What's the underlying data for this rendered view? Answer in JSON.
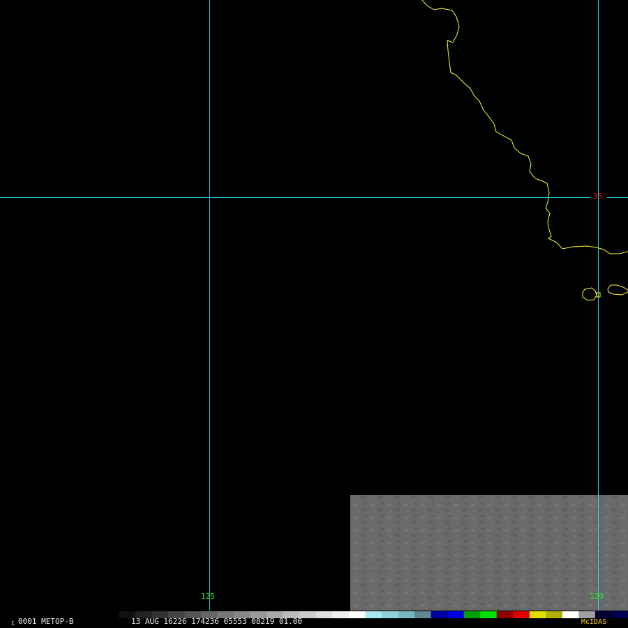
{
  "satellite": {
    "frame_number": "0001",
    "frame_prefix": "1",
    "name": "METOP-B",
    "datetime_line": "13 AUG 16226 174236 05553 08219 01.00",
    "brand": "McIDAS"
  },
  "grid": {
    "longitude_labels": [
      "125",
      "120"
    ],
    "latitude_labels": [
      "35"
    ],
    "grid_line_color": "#2fd0e8",
    "longitude_label_color": "#22e022",
    "latitude_label_color": "#e02020"
  },
  "coastline": {
    "color": "#ffff33"
  },
  "imagery": {
    "tone": "#6b6b6b"
  },
  "colorbar": {
    "segments": [
      {
        "color": "#000000"
      },
      {
        "color": "#111111"
      },
      {
        "color": "#222222"
      },
      {
        "color": "#333333"
      },
      {
        "color": "#444444"
      },
      {
        "color": "#555555"
      },
      {
        "color": "#666666"
      },
      {
        "color": "#777777"
      },
      {
        "color": "#888888"
      },
      {
        "color": "#999999"
      },
      {
        "color": "#aaaaaa"
      },
      {
        "color": "#bbbbbb"
      },
      {
        "color": "#cccccc"
      },
      {
        "color": "#dddddd"
      },
      {
        "color": "#eeeeee"
      },
      {
        "color": "#ffffff"
      },
      {
        "color": "#a8e8ee"
      },
      {
        "color": "#90d0d8"
      },
      {
        "color": "#78b8c0"
      },
      {
        "color": "#608890"
      },
      {
        "color": "#0000a0"
      },
      {
        "color": "#0000e0"
      },
      {
        "color": "#00a000"
      },
      {
        "color": "#00e000"
      },
      {
        "color": "#900000"
      },
      {
        "color": "#e00000"
      },
      {
        "color": "#e0e000"
      },
      {
        "color": "#b0b000"
      },
      {
        "color": "#ffffff"
      },
      {
        "color": "#a0a0a0"
      },
      {
        "color": "#000030"
      },
      {
        "color": "#000050"
      }
    ]
  }
}
